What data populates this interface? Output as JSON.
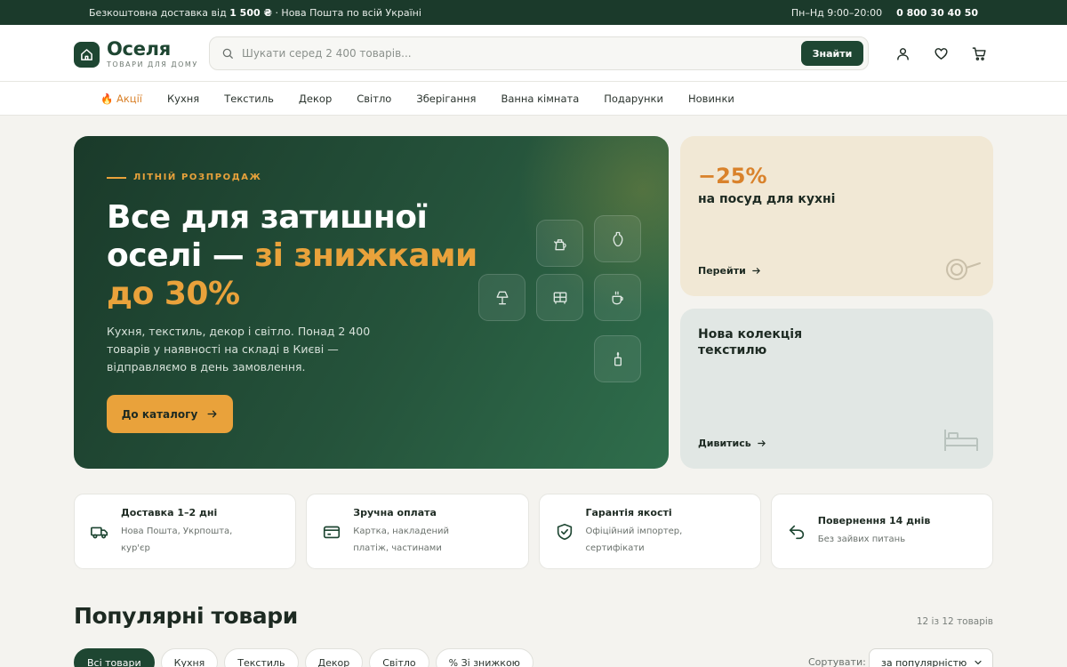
{
  "topbar": {
    "shipping_prefix": "Безкоштовна доставка від",
    "shipping_amount": "1 500 ₴",
    "shipping_suffix": "· Нова Пошта по всій Україні",
    "hours": "Пн–Нд 9:00–20:00",
    "phone": "0 800 30 40 50"
  },
  "header": {
    "logo_name": "Оселя",
    "logo_tagline": "ТОВАРИ ДЛЯ ДОМУ",
    "search_placeholder": "Шукати серед 2 400 товарів...",
    "search_button": "Знайти",
    "icons": [
      "user-icon",
      "heart-icon",
      "cart-icon"
    ]
  },
  "nav": {
    "items": [
      "🔥 Акції",
      "Кухня",
      "Текстиль",
      "Декор",
      "Світло",
      "Зберігання",
      "Ванна кімната",
      "Подарунки",
      "Новинки"
    ]
  },
  "hero": {
    "eyebrow": "ЛІТНІЙ РОЗПРОДАЖ",
    "title_main": "Все для затишної оселі — ",
    "title_highlight": "зі знижками до 30%",
    "description": "Кухня, текстиль, декор і світло. Понад 2 400 товарів у наявності на складі в Києві — відправляємо в день замовлення.",
    "cta": "До каталогу",
    "tile_icons": [
      "kettle-icon",
      "vase-icon",
      "lamp-icon",
      "cabinet-icon",
      "cup-icon",
      "candle-icon"
    ]
  },
  "promo_cookware": {
    "discount": "−25%",
    "text": "на посуд для кухні",
    "link": "Перейти",
    "icon": "pan-icon"
  },
  "promo_textile": {
    "text": "Нова колекція текстилю",
    "link": "Дивитись",
    "icon": "bed-icon"
  },
  "features": [
    {
      "icon": "truck-icon",
      "title": "Доставка 1–2 дні",
      "desc": "Нова Пошта, Укрпошта, кур'єр"
    },
    {
      "icon": "card-icon",
      "title": "Зручна оплата",
      "desc": "Картка, накладений платіж, частинами"
    },
    {
      "icon": "shield-icon",
      "title": "Гарантія якості",
      "desc": "Офіційний імпортер, сертифікати"
    },
    {
      "icon": "return-icon",
      "title": "Повернення 14 днів",
      "desc": "Без зайвих питань"
    }
  ],
  "popular": {
    "title": "Популярні товари",
    "count": "12 із 12 товарів",
    "filters": [
      "Всі товари",
      "Кухня",
      "Текстиль",
      "Декор",
      "Світло",
      "% Зі знижкою"
    ],
    "active_filter": "Всі товари",
    "sort_label": "Сортувати:",
    "sort_value": "за популярністю"
  },
  "colors": {
    "brand_green": "#1e4632",
    "accent_orange": "#e9a23b",
    "promo_beige": "#f1e8d5",
    "promo_mint": "#e1e7e4"
  }
}
